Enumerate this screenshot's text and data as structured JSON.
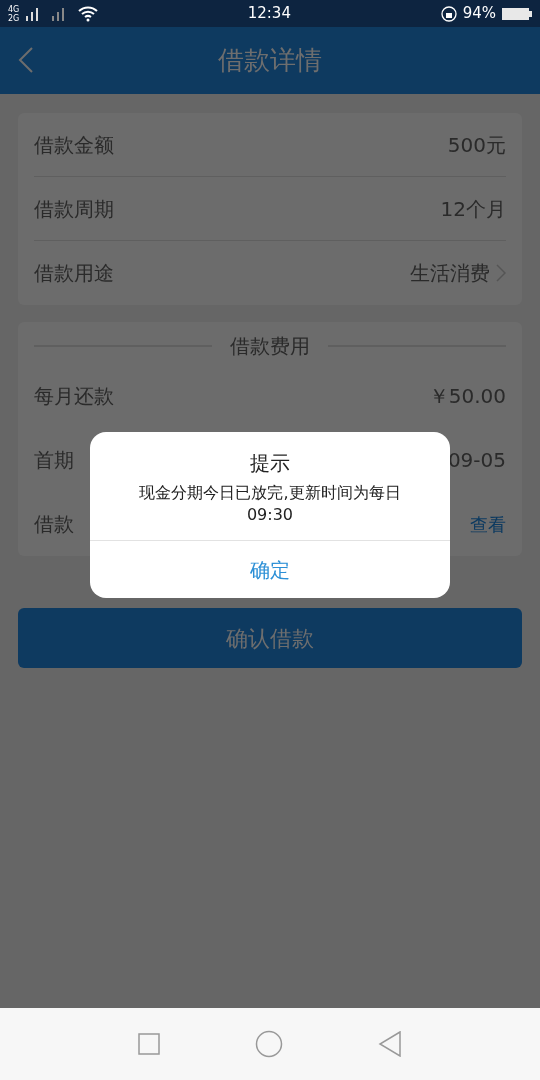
{
  "status_bar": {
    "network": "4G 2G",
    "time": "12:34",
    "battery": "94%"
  },
  "header": {
    "title": "借款详情"
  },
  "loan_card": {
    "rows": [
      {
        "kind": "plain",
        "label": "借款金额",
        "value": "500元"
      },
      {
        "kind": "plain",
        "label": "借款周期",
        "value": "12个月"
      },
      {
        "kind": "link",
        "label": "借款用途",
        "value": "生活消费"
      }
    ]
  },
  "fee_card": {
    "title": "借款费用",
    "rows": [
      {
        "kind": "plain",
        "label": "每月还款",
        "value": "￥50.00"
      },
      {
        "kind": "plain",
        "label": "首期",
        "value": "09-05"
      },
      {
        "kind": "action",
        "label": "借款",
        "value": "查看"
      }
    ]
  },
  "confirm_button": "确认借款",
  "dialog": {
    "title": "提示",
    "message": "现金分期今日已放完,更新时间为每日09:30",
    "ok": "确定"
  }
}
